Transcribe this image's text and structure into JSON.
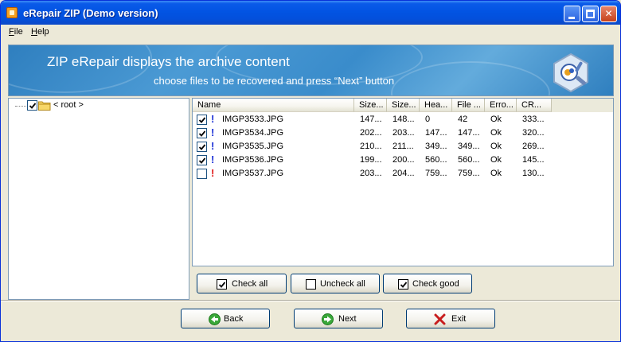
{
  "window": {
    "title": "eRepair ZIP (Demo version)"
  },
  "menu": {
    "file": {
      "hotkey": "F",
      "rest": "ile"
    },
    "help": {
      "hotkey": "H",
      "rest": "elp"
    }
  },
  "banner": {
    "title": "ZIP eRepair displays the archive content",
    "subtitle": "choose files to be recovered and press “Next” button"
  },
  "tree": {
    "root_label": "< root >",
    "root_checked": true
  },
  "columns": [
    "Name",
    "Size...",
    "Size...",
    "Hea...",
    "File ...",
    "Erro...",
    "CR..."
  ],
  "files": [
    {
      "checked": true,
      "status": "ok",
      "name": "IMGP3533.JPG",
      "size1": "147...",
      "size2": "148...",
      "hea": "0",
      "file": "42",
      "err": "Ok",
      "crc": "333..."
    },
    {
      "checked": true,
      "status": "ok",
      "name": "IMGP3534.JPG",
      "size1": "202...",
      "size2": "203...",
      "hea": "147...",
      "file": "147...",
      "err": "Ok",
      "crc": "320..."
    },
    {
      "checked": true,
      "status": "ok",
      "name": "IMGP3535.JPG",
      "size1": "210...",
      "size2": "211...",
      "hea": "349...",
      "file": "349...",
      "err": "Ok",
      "crc": "269..."
    },
    {
      "checked": true,
      "status": "ok",
      "name": "IMGP3536.JPG",
      "size1": "199...",
      "size2": "200...",
      "hea": "560...",
      "file": "560...",
      "err": "Ok",
      "crc": "145..."
    },
    {
      "checked": false,
      "status": "bad",
      "name": "IMGP3537.JPG",
      "size1": "203...",
      "size2": "204...",
      "hea": "759...",
      "file": "759...",
      "err": "Ok",
      "crc": "130..."
    }
  ],
  "status_marks": {
    "ok": "!",
    "bad": "!"
  },
  "colors": {
    "ok_mark": "#1a2fd6",
    "bad_mark": "#e01818",
    "titlebar": "#0254e3",
    "back_icon": "#3aa83a",
    "next_icon": "#3aa83a",
    "exit_icon": "#c81e1e"
  },
  "buttons": {
    "check_all": "Check all",
    "uncheck_all": "Uncheck all",
    "check_good": "Check good",
    "back": "Back",
    "next": "Next",
    "exit": "Exit"
  },
  "icons": {
    "app": "app-icon",
    "folder": "folder-icon",
    "logo": "erepair-logo-icon",
    "back": "back-arrow-icon",
    "next": "next-arrow-icon",
    "exit": "exit-x-icon"
  }
}
